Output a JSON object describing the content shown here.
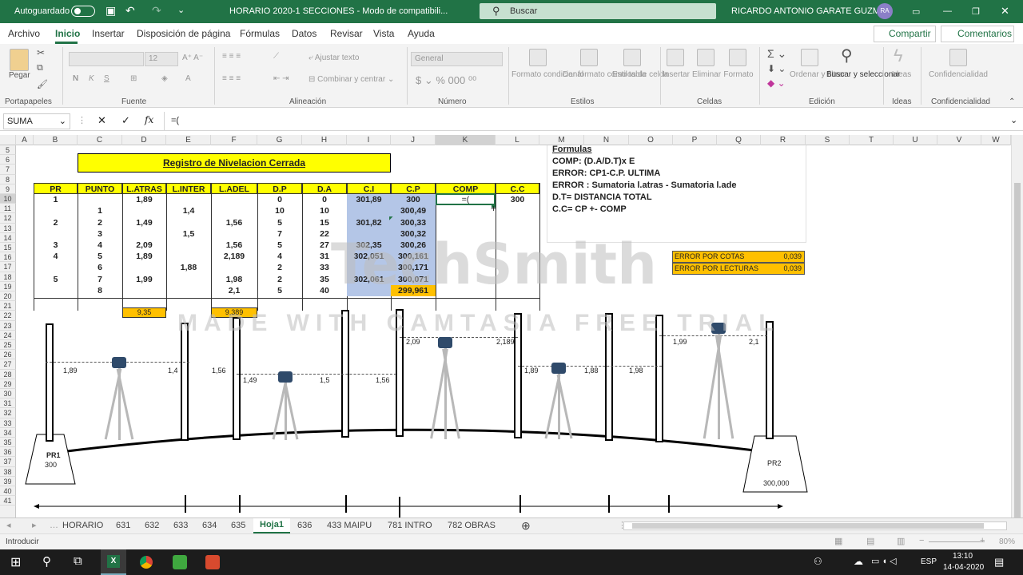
{
  "titlebar": {
    "autosave": "Autoguardado",
    "doc_title": "HORARIO 2020-1 SECCIONES  -  Modo de compatibili...",
    "search": "Buscar",
    "user": "RICARDO  ANTONIO GARATE GUZMAN",
    "initials": "RA"
  },
  "menu": [
    "Archivo",
    "Inicio",
    "Insertar",
    "Disposición de página",
    "Fórmulas",
    "Datos",
    "Revisar",
    "Vista",
    "Ayuda"
  ],
  "share": "Compartir",
  "comments": "Comentarios",
  "ribbon": {
    "paste": "Pegar",
    "portapapeles": "Portapapeles",
    "fuente": "Fuente",
    "font_size": "12",
    "ajustar": "Ajustar texto",
    "combinar": "Combinar y centrar",
    "alineacion": "Alineación",
    "general": "General",
    "numero": "Número",
    "formato_cond": "Formato condicional",
    "formato_tabla": "Dar formato como tabla",
    "estilos_celda": "Estilos de celda",
    "estilos": "Estilos",
    "insertar": "Insertar",
    "eliminar": "Eliminar",
    "formato": "Formato",
    "celdas": "Celdas",
    "ordenar": "Ordenar y filtrar",
    "buscar": "Buscar y seleccionar",
    "edicion": "Edición",
    "ideas": "Ideas",
    "confidencialidad": "Confidencialidad"
  },
  "formula_bar": {
    "name_box": "SUMA",
    "formula": "=("
  },
  "columns": [
    "A",
    "B",
    "C",
    "D",
    "E",
    "F",
    "G",
    "H",
    "I",
    "J",
    "K",
    "L",
    "M",
    "N",
    "O",
    "P",
    "Q",
    "R",
    "S",
    "T",
    "U",
    "V",
    "W"
  ],
  "rows": [
    "5",
    "6",
    "7",
    "8",
    "9",
    "10",
    "11",
    "12",
    "13",
    "14",
    "15",
    "16",
    "17",
    "18",
    "19",
    "20",
    "21",
    "22",
    "23",
    "24",
    "25",
    "26",
    "27",
    "28",
    "29",
    "30",
    "31",
    "32",
    "33",
    "34",
    "35",
    "36",
    "37",
    "38",
    "39",
    "40",
    "41"
  ],
  "sheet": {
    "title": "Registro de Nivelacion  Cerrada",
    "headers": [
      "PR",
      "PUNTO",
      "L.ATRAS",
      "L.INTER",
      "L.ADEL",
      "D.P",
      "D.A",
      "C.I",
      "C.P",
      "COMP",
      "C.C"
    ],
    "table": [
      [
        "1",
        "",
        "1,89",
        "",
        "",
        "0",
        "0",
        "301,89",
        "300",
        "=(",
        "300"
      ],
      [
        "",
        "1",
        "",
        "1,4",
        "",
        "10",
        "10",
        "",
        "300,49",
        "",
        ""
      ],
      [
        "2",
        "2",
        "1,49",
        "",
        "1,56",
        "5",
        "15",
        "301,82",
        "300,33",
        "",
        ""
      ],
      [
        "",
        "3",
        "",
        "1,5",
        "",
        "7",
        "22",
        "",
        "300,32",
        "",
        ""
      ],
      [
        "3",
        "4",
        "2,09",
        "",
        "1,56",
        "5",
        "27",
        "302,35",
        "300,26",
        "",
        ""
      ],
      [
        "4",
        "5",
        "1,89",
        "",
        "2,189",
        "4",
        "31",
        "302,051",
        "300,161",
        "",
        ""
      ],
      [
        "",
        "6",
        "",
        "1,88",
        "",
        "2",
        "33",
        "",
        "300,171",
        "",
        ""
      ],
      [
        "5",
        "7",
        "1,99",
        "",
        "1,98",
        "2",
        "35",
        "302,061",
        "300,071",
        "",
        ""
      ],
      [
        "",
        "8",
        "",
        "",
        "2,1",
        "5",
        "40",
        "",
        "299,961",
        "",
        ""
      ]
    ],
    "sum_atras": "9,35",
    "sum_adel": "9,389",
    "formulas": [
      "Formulas",
      "COMP: (D.A/D.T)x E",
      "ERROR: CP1-C.P. ULTIMA",
      "ERROR : Sumatoria l.atras - Sumatoria l.ade",
      "D.T= DISTANCIA TOTAL",
      "C.C= CP +- COMP"
    ],
    "errors": [
      {
        "label": "ERROR  POR COTAS",
        "value": "0,039"
      },
      {
        "label": "ERROR POR LECTURAS",
        "value": "0,039"
      }
    ]
  },
  "diagram": {
    "readings": [
      "1,89",
      "1,4",
      "1,56",
      "1,49",
      "1,5",
      "1,56",
      "2,09",
      "2,189",
      "1,89",
      "1,88",
      "1,98",
      "1,99",
      "2,1"
    ],
    "pr1": {
      "name": "PR1",
      "value": "300"
    },
    "pr2": {
      "name": "PR2",
      "value": "300,000"
    }
  },
  "watermark": {
    "logo": "TechSmith",
    "line": "MADE WITH CAMTASIA FREE TRIAL"
  },
  "tabs": [
    "HORARIO",
    "631",
    "632",
    "633",
    "634",
    "635",
    "Hoja1",
    "636",
    "433 MAIPU",
    "781 INTRO",
    "782 OBRAS"
  ],
  "active_tab": "Hoja1",
  "status": {
    "mode": "Introducir",
    "zoom": "80%"
  },
  "taskbar": {
    "time": "13:10",
    "date": "14-04-2020",
    "lang": "ESP"
  },
  "colors": {
    "excel_green": "#217346",
    "header_yellow": "#ffff00",
    "cell_blue": "#b4c6e7",
    "cell_orange": "#ffc000"
  }
}
